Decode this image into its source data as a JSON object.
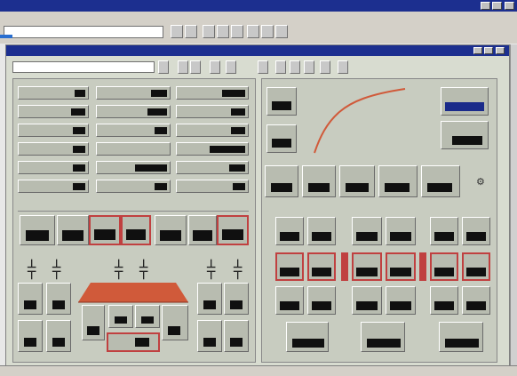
{
  "window": {
    "title": ""
  },
  "menu": {
    "items": [
      "",
      "",
      "",
      "",
      "",
      "",
      ""
    ]
  },
  "toolbar": {
    "combo": ""
  },
  "child": {
    "title": "",
    "combo": ""
  },
  "status": {
    "text": ""
  },
  "sections": {
    "immediate": "",
    "col1": "",
    "col2": "",
    "col3": ""
  },
  "colors": {
    "titlebar": "#1c2f8f",
    "highlight": "#c04040",
    "curve": "#d05a3a",
    "readout": "#1a2a8a"
  }
}
